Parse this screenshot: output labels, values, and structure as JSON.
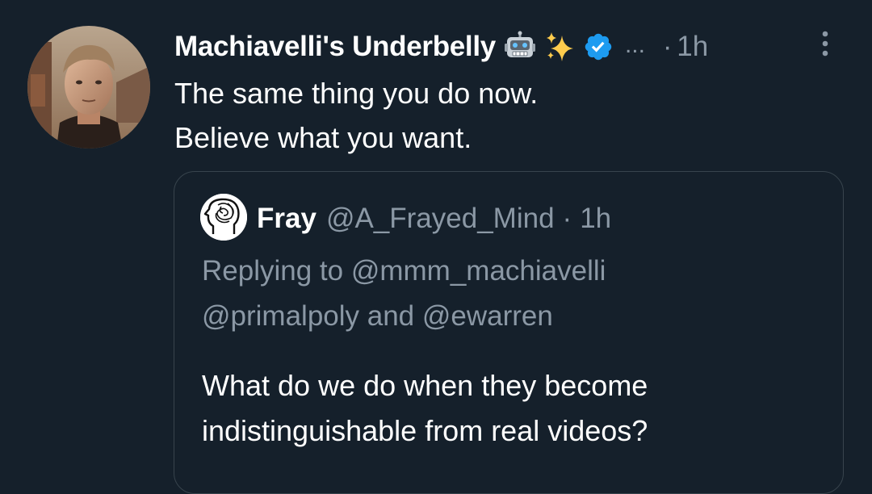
{
  "tweet": {
    "display_name": "Machiavelli's Underbelly",
    "name_emojis": [
      "robot-face-emoji",
      "sparkles-emoji"
    ],
    "verified": true,
    "overflow_marker": "...",
    "separator": "·",
    "time": "1h",
    "text_lines": [
      "The same thing you do now.",
      "Believe what you want."
    ],
    "menu_icon": "vertical-ellipsis-icon"
  },
  "quoted_tweet": {
    "display_name": "Fray",
    "handle": "@A_Frayed_Mind",
    "separator": "·",
    "time": "1h",
    "replying_lines": [
      "Replying to @mmm_machiavelli",
      "@primalpoly and @ewarren"
    ],
    "text_lines": [
      "What do we do when they become",
      "indistinguishable from real videos?"
    ]
  },
  "colors": {
    "background": "#15202b",
    "primary_text": "#ffffff",
    "secondary_text": "#8b98a5",
    "border": "#38444d",
    "verified_blue": "#1d9bf0"
  }
}
